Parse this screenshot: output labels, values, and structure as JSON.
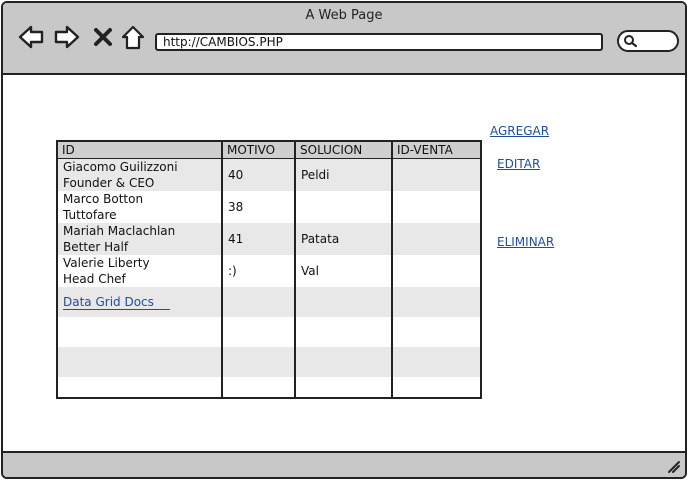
{
  "window": {
    "title": "A Web Page"
  },
  "browser": {
    "url": "http://CAMBIOS.PHP",
    "icons": [
      "back-arrow-icon",
      "forward-arrow-icon",
      "close-x-icon",
      "home-icon",
      "search-icon",
      "resize-grip-icon"
    ]
  },
  "table": {
    "headers": [
      "ID",
      "MOTIVO",
      "SOLUCION",
      "ID-VENTA"
    ],
    "rows": [
      {
        "id_line1": "Giacomo Guilizzoni",
        "id_line2": "Founder & CEO",
        "motivo": "40",
        "solucion": "Peldi",
        "id_venta": ""
      },
      {
        "id_line1": "Marco Botton",
        "id_line2": "Tuttofare",
        "motivo": "38",
        "solucion": "",
        "id_venta": ""
      },
      {
        "id_line1": "Mariah Maclachlan",
        "id_line2": "Better Half",
        "motivo": "41",
        "solucion": "Patata",
        "id_venta": ""
      },
      {
        "id_line1": "Valerie Liberty",
        "id_line2": "Head Chef",
        "motivo": ":)",
        "solucion": "Val",
        "id_venta": ""
      }
    ],
    "footer_link": "Data Grid Docs"
  },
  "actions": {
    "agregar": "AGREGAR",
    "editar": "EDITAR",
    "eliminar": "ELIMINAR"
  },
  "colors": {
    "chrome": "#c8c8c8",
    "link": "#1f4e9a",
    "alt_row": "#e8e8e8"
  }
}
